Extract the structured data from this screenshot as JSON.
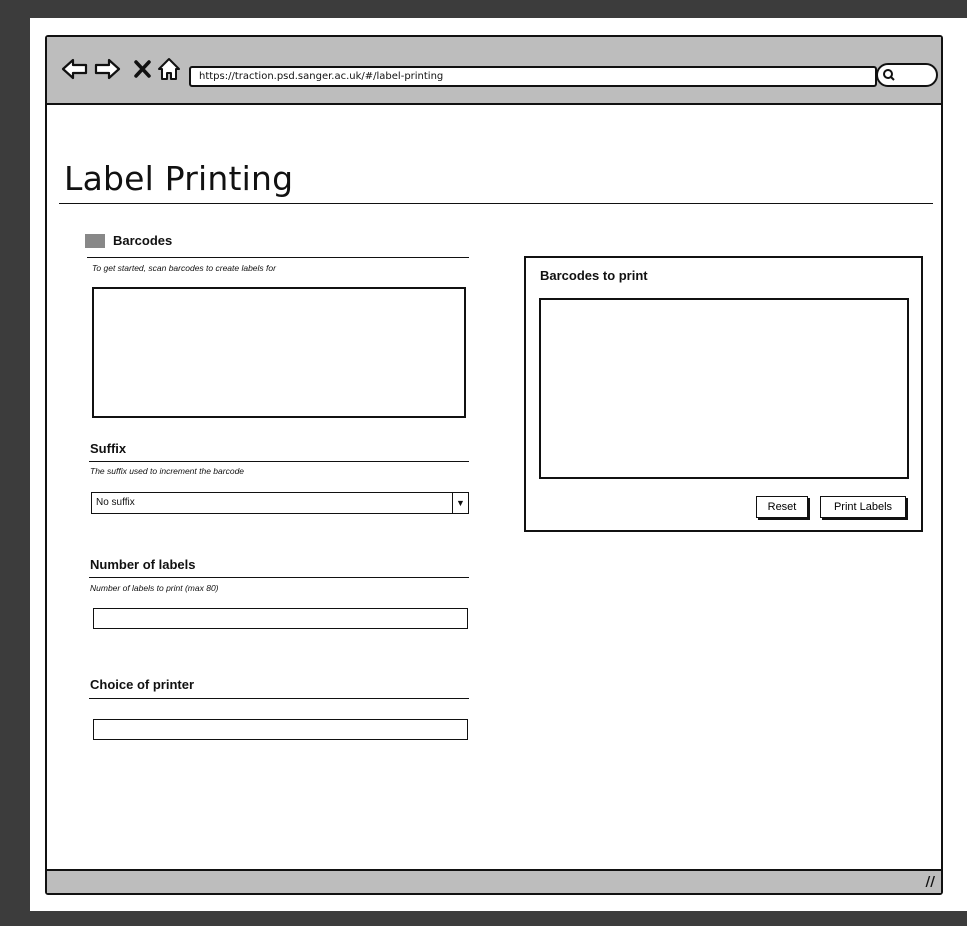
{
  "browser": {
    "url": "https://traction.psd.sanger.ac.uk/#/label-printing"
  },
  "page": {
    "title": "Label Printing"
  },
  "barcodes": {
    "heading": "Barcodes",
    "hint": "To get started, scan barcodes to create labels for"
  },
  "suffix": {
    "heading": "Suffix",
    "hint": "The suffix used to increment the barcode",
    "selected": "No suffix"
  },
  "labels": {
    "heading": "Number of labels",
    "hint": "Number of labels to print (max 80)"
  },
  "printer": {
    "heading": "Choice of printer"
  },
  "to_print": {
    "heading": "Barcodes to print",
    "reset_label": "Reset",
    "print_label": "Print Labels"
  }
}
